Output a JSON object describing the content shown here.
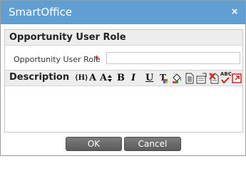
{
  "window": {
    "title": "SmartOffice",
    "close_symbol": "×"
  },
  "section": {
    "title": "Opportunity User Role"
  },
  "field": {
    "label": "Opportunity User Role",
    "required_mark": "*",
    "value": ""
  },
  "editor": {
    "label": "Description",
    "tools": [
      {
        "name": "font-family-icon",
        "glyph": "⟨H⟩"
      },
      {
        "name": "font-size-icon",
        "glyph": "A"
      },
      {
        "name": "resize-font-icon",
        "glyph": "A"
      },
      {
        "name": "bold-icon",
        "glyph": "B"
      },
      {
        "name": "italic-icon",
        "glyph": "I"
      },
      {
        "name": "underline-icon",
        "glyph": "U"
      },
      {
        "name": "text-color-icon",
        "glyph": "T"
      },
      {
        "name": "fill-color-icon",
        "glyph": ""
      },
      {
        "name": "insert-document-icon",
        "glyph": ""
      },
      {
        "name": "insert-template-icon",
        "glyph": ""
      },
      {
        "name": "remove-format-icon",
        "glyph": ""
      },
      {
        "name": "spell-check-icon",
        "glyph": "ABC"
      },
      {
        "name": "html-source-icon",
        "glyph": ""
      }
    ],
    "value": ""
  },
  "buttons": {
    "ok": "OK",
    "cancel": "Cancel"
  },
  "colors": {
    "titlebar": "#5f9fd4",
    "required": "#cc1f1f",
    "button": "#6a6a6a"
  }
}
